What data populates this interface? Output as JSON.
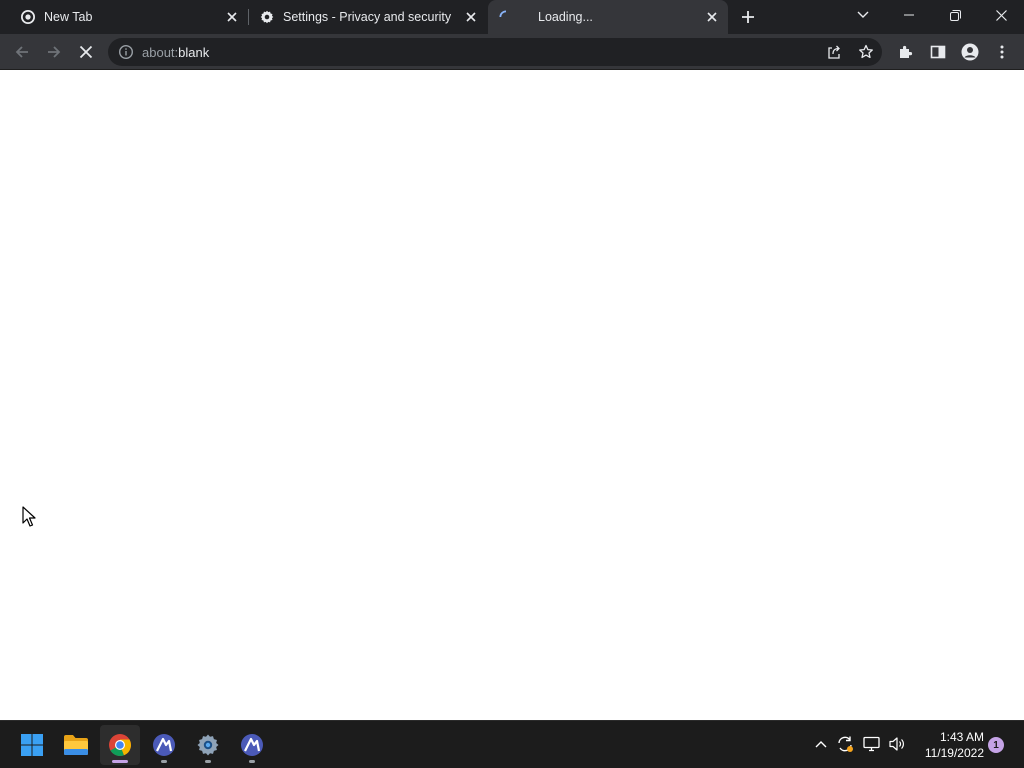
{
  "browser": {
    "tabs": [
      {
        "title": "New Tab",
        "favicon": "chrome-icon",
        "active": false
      },
      {
        "title": "Settings - Privacy and security",
        "favicon": "gear-icon",
        "active": false
      },
      {
        "title": "Loading...",
        "favicon": "loading-spinner-icon",
        "active": true
      }
    ],
    "address_bar": {
      "scheme": "about:",
      "host": "blank",
      "security_icon": "info-icon"
    },
    "colors": {
      "tabstrip_bg": "#202124",
      "active_tab_bg": "#35363a",
      "omnibox_bg": "#202124"
    }
  },
  "taskbar": {
    "apps": [
      {
        "name": "Start",
        "icon": "windows-start-icon"
      },
      {
        "name": "File Explorer",
        "icon": "folder-icon"
      },
      {
        "name": "Google Chrome",
        "icon": "chrome-icon",
        "active": true
      },
      {
        "name": "App",
        "icon": "app-icon"
      },
      {
        "name": "Settings",
        "icon": "settings-gear-icon"
      },
      {
        "name": "App",
        "icon": "app-icon"
      }
    ],
    "tray": {
      "time": "1:43 AM",
      "date": "11/19/2022",
      "notification_count": "1"
    }
  }
}
